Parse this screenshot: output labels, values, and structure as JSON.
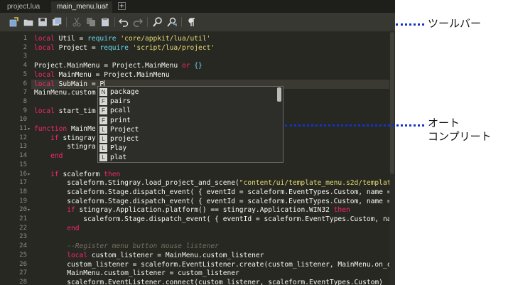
{
  "tabs": [
    {
      "label": "project.lua",
      "active": false
    },
    {
      "label": "main_menu.lua*",
      "active": true
    }
  ],
  "tab_close_glyph": "✕",
  "add_tab_glyph": "+",
  "toolbar_icons": [
    "new-file-icon",
    "open-folder-icon",
    "save-icon",
    "save-all-icon",
    "cut-icon",
    "copy-icon",
    "paste-icon",
    "undo-icon",
    "redo-icon",
    "find-icon",
    "find-replace-icon",
    "pilcrow-icon"
  ],
  "line_numbers": [
    "1",
    "2",
    "3",
    "4",
    "5",
    "6",
    "7",
    "8",
    "9",
    "10",
    "11",
    "12",
    "13",
    "14",
    "15",
    "16",
    "17",
    "18",
    "19",
    "20",
    "21",
    "22",
    "23",
    "24",
    "25",
    "26",
    "27",
    "28"
  ],
  "code_lines": [
    [
      [
        "local ",
        "kw"
      ],
      [
        "Util = ",
        ""
      ],
      [
        "require ",
        "cst"
      ],
      [
        "'core/appkit/lua/util'",
        "str"
      ]
    ],
    [
      [
        "local ",
        "kw"
      ],
      [
        "Project = ",
        ""
      ],
      [
        "require ",
        "cst"
      ],
      [
        "'script/lua/project'",
        "str"
      ]
    ],
    [],
    [
      [
        "Project.MainMenu = Project.MainMenu ",
        ""
      ],
      [
        "or ",
        "kw"
      ],
      [
        "{}",
        "cst"
      ]
    ],
    [
      [
        "local ",
        "kw"
      ],
      [
        "MainMenu = Project.MainMenu",
        ""
      ]
    ],
    [
      [
        "local ",
        "kw"
      ],
      [
        "SubMain = P",
        ""
      ]
    ],
    [
      [
        "MainMenu.custom",
        ""
      ]
    ],
    [],
    [
      [
        "local ",
        "kw"
      ],
      [
        "start_tim",
        ""
      ]
    ],
    [],
    [
      [
        "function ",
        "kw"
      ],
      [
        "MainMe",
        ""
      ]
    ],
    [
      [
        "    ",
        ""
      ],
      [
        "if ",
        "kw"
      ],
      [
        "stingray",
        ""
      ]
    ],
    [
      [
        "        stingra",
        ""
      ]
    ],
    [
      [
        "    ",
        ""
      ],
      [
        "end",
        "kw"
      ]
    ],
    [],
    [
      [
        "    ",
        ""
      ],
      [
        "if ",
        "kw"
      ],
      [
        "scaleform ",
        ""
      ],
      [
        "then",
        "kw"
      ]
    ],
    [
      [
        "        scaleform.Stingray.load_project_and_scene(",
        ""
      ],
      [
        "\"content/ui/template_menu.s2d/templat",
        "str"
      ]
    ],
    [
      [
        "        scaleform.Stage.dispatch_event( { eventId = scaleform.EventTypes.Custom, name = ",
        ""
      ]
    ],
    [
      [
        "        scaleform.Stage.dispatch_event( { eventId = scaleform.EventTypes.Custom, name = ",
        ""
      ]
    ],
    [
      [
        "        ",
        ""
      ],
      [
        "if ",
        "kw"
      ],
      [
        "stingray.Application.platform() == stingray.Application.WIN32 ",
        ""
      ],
      [
        "then",
        "kw"
      ]
    ],
    [
      [
        "            scaleform.Stage.dispatch_event( { eventId = scaleform.EventTypes.Custom, na",
        ""
      ]
    ],
    [
      [
        "        ",
        ""
      ],
      [
        "end",
        "kw"
      ]
    ],
    [],
    [
      [
        "        --Register menu button mouse listener",
        "cm"
      ]
    ],
    [
      [
        "        ",
        ""
      ],
      [
        "local ",
        "kw"
      ],
      [
        "custom_listener = MainMenu.custom_listener",
        ""
      ]
    ],
    [
      [
        "        custom_listener = scaleform.EventListener.create(custom_listener, MainMenu.on_c",
        ""
      ]
    ],
    [
      [
        "        MainMenu.custom_listener = custom_listener",
        ""
      ]
    ],
    [
      [
        "        scaleform.EventListener.connect(custom_listener, scaleform.EventTypes.Custom)",
        ""
      ]
    ]
  ],
  "fold_lines": [
    11,
    16,
    20
  ],
  "current_line": 6,
  "autocomplete": [
    {
      "kind": "N",
      "text": "package"
    },
    {
      "kind": "F",
      "text": "pairs"
    },
    {
      "kind": "F",
      "text": "pcall"
    },
    {
      "kind": "F",
      "text": "print"
    },
    {
      "kind": "L",
      "text": "Project"
    },
    {
      "kind": "L",
      "text": "project"
    },
    {
      "kind": "L",
      "text": "Play"
    },
    {
      "kind": "L",
      "text": "plat"
    }
  ],
  "annotations": {
    "toolbar_label": "ツールバー",
    "autocomplete_label_line1": "オート",
    "autocomplete_label_line2": "コンプリート"
  },
  "colors": {
    "editor_bg": "#272822",
    "keyword": "#f92672",
    "string": "#e6db74",
    "comment": "#75715e",
    "callout": "#1433cc"
  }
}
